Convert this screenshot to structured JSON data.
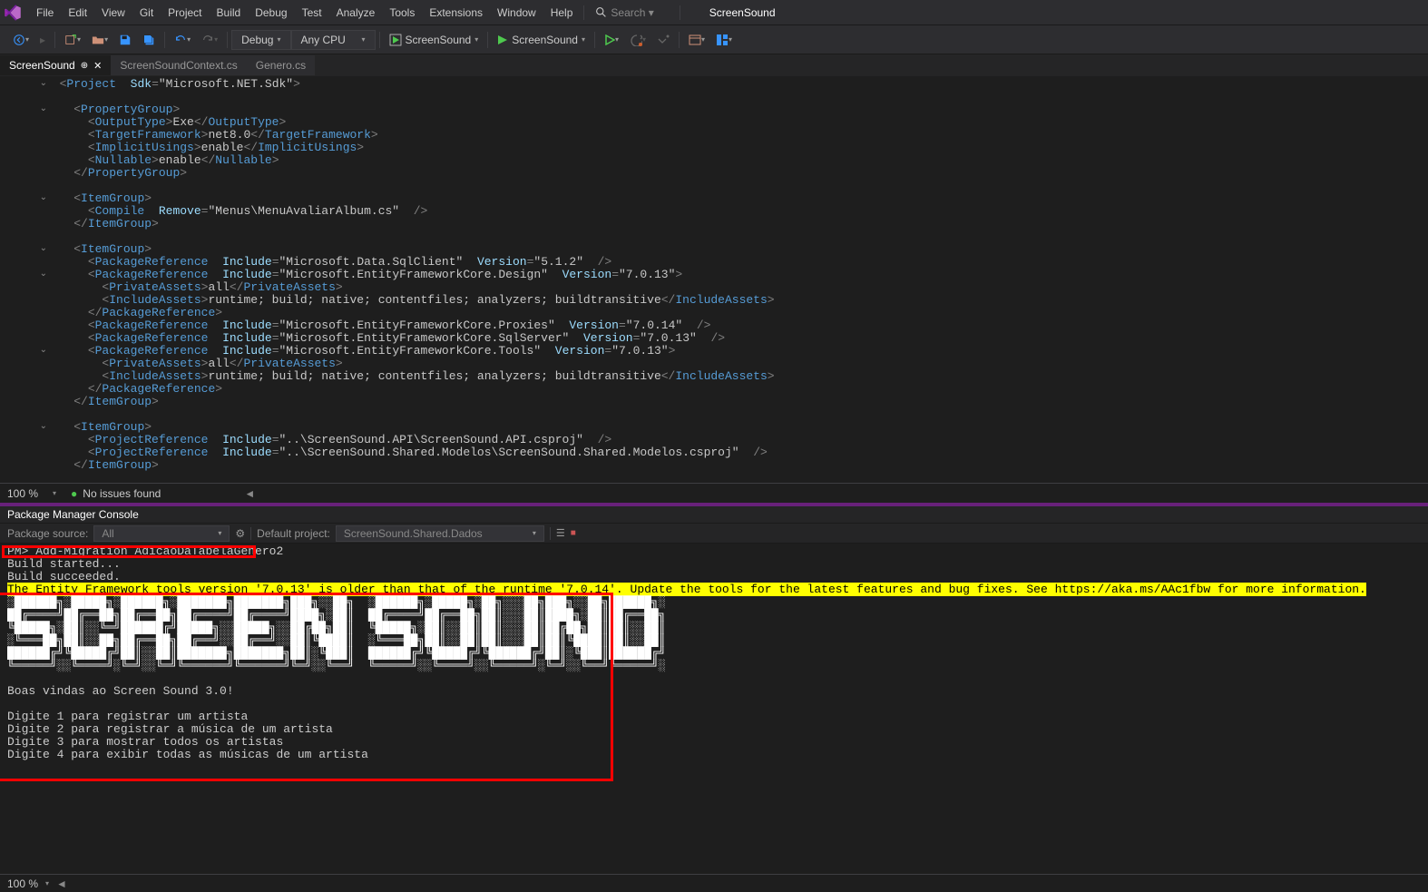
{
  "app_title": "ScreenSound",
  "menubar": [
    "File",
    "Edit",
    "View",
    "Git",
    "Project",
    "Build",
    "Debug",
    "Test",
    "Analyze",
    "Tools",
    "Extensions",
    "Window",
    "Help"
  ],
  "search_placeholder": "Search ▾",
  "toolbar": {
    "debug_config": "Debug",
    "platform": "Any CPU",
    "startup1": "ScreenSound",
    "startup2": "ScreenSound"
  },
  "tabs": [
    {
      "label": "ScreenSound",
      "active": true,
      "pinned": true
    },
    {
      "label": "ScreenSoundContext.cs",
      "active": false,
      "pinned": false
    },
    {
      "label": "Genero.cs",
      "active": false,
      "pinned": false
    }
  ],
  "editor_lines": [
    {
      "collapse": "▾",
      "indent": 0,
      "raw": "<Project Sdk=\"Microsoft.NET.Sdk\">"
    },
    {
      "indent": 0,
      "raw": ""
    },
    {
      "collapse": "▾",
      "indent": 1,
      "raw": "<PropertyGroup>"
    },
    {
      "indent": 2,
      "raw": "<OutputType>Exe</OutputType>"
    },
    {
      "indent": 2,
      "raw": "<TargetFramework>net8.0</TargetFramework>"
    },
    {
      "indent": 2,
      "raw": "<ImplicitUsings>enable</ImplicitUsings>"
    },
    {
      "indent": 2,
      "raw": "<Nullable>enable</Nullable>"
    },
    {
      "indent": 1,
      "raw": "</PropertyGroup>"
    },
    {
      "indent": 0,
      "raw": ""
    },
    {
      "collapse": "▾",
      "indent": 1,
      "raw": "<ItemGroup>"
    },
    {
      "indent": 2,
      "raw": "<Compile Remove=\"Menus\\MenuAvaliarAlbum.cs\" />"
    },
    {
      "indent": 1,
      "raw": "</ItemGroup>"
    },
    {
      "indent": 0,
      "raw": ""
    },
    {
      "collapse": "▾",
      "indent": 1,
      "raw": "<ItemGroup>"
    },
    {
      "indent": 2,
      "raw": "<PackageReference Include=\"Microsoft.Data.SqlClient\" Version=\"5.1.2\" />"
    },
    {
      "collapse": "▾",
      "indent": 2,
      "raw": "<PackageReference Include=\"Microsoft.EntityFrameworkCore.Design\" Version=\"7.0.13\">"
    },
    {
      "indent": 3,
      "raw": "<PrivateAssets>all</PrivateAssets>"
    },
    {
      "indent": 3,
      "raw": "<IncludeAssets>runtime; build; native; contentfiles; analyzers; buildtransitive</IncludeAssets>"
    },
    {
      "indent": 2,
      "raw": "</PackageReference>"
    },
    {
      "indent": 2,
      "raw": "<PackageReference Include=\"Microsoft.EntityFrameworkCore.Proxies\" Version=\"7.0.14\" />"
    },
    {
      "indent": 2,
      "raw": "<PackageReference Include=\"Microsoft.EntityFrameworkCore.SqlServer\" Version=\"7.0.13\" />"
    },
    {
      "collapse": "▾",
      "indent": 2,
      "raw": "<PackageReference Include=\"Microsoft.EntityFrameworkCore.Tools\" Version=\"7.0.13\">"
    },
    {
      "indent": 3,
      "raw": "<PrivateAssets>all</PrivateAssets>"
    },
    {
      "indent": 3,
      "raw": "<IncludeAssets>runtime; build; native; contentfiles; analyzers; buildtransitive</IncludeAssets>"
    },
    {
      "indent": 2,
      "raw": "</PackageReference>"
    },
    {
      "indent": 1,
      "raw": "</ItemGroup>"
    },
    {
      "indent": 0,
      "raw": ""
    },
    {
      "collapse": "▾",
      "indent": 1,
      "raw": "<ItemGroup>"
    },
    {
      "indent": 2,
      "raw": "<ProjectReference Include=\"..\\ScreenSound.API\\ScreenSound.API.csproj\" />"
    },
    {
      "indent": 2,
      "raw": "<ProjectReference Include=\"..\\ScreenSound.Shared.Modelos\\ScreenSound.Shared.Modelos.csproj\" />"
    },
    {
      "indent": 1,
      "raw": "</ItemGroup>"
    }
  ],
  "editor_status": {
    "zoom": "100 %",
    "issues": "No issues found"
  },
  "panel": {
    "title": "Package Manager Console",
    "source_label": "Package source:",
    "source_value": "All",
    "default_label": "Default project:",
    "default_value": "ScreenSound.Shared.Dados"
  },
  "console": {
    "prompt": "PM>",
    "command": "Add-Migration AdicaoDaTabelaGenero2",
    "build_started": "Build started...",
    "build_succeeded": "Build succeeded.",
    "warning": "The Entity Framework tools version '7.0.13' is older than that of the runtime '7.0.14'. Update the tools for the latest features and bug fixes. See https://aka.ms/AAc1fbw for more information.",
    "ascii": "░██████╗░█████╗░██████╗░███████╗███████╗███╗░░██╗  ░██████╗░█████╗░██╗░░░██╗███╗░░██╗██████╗░\n██╔════╝██╔══██╗██╔══██╗██╔════╝██╔════╝████╗░██║  ██╔════╝██╔══██╗██║░░░██║████╗░██║██╔══██╗\n╚█████╗░██║░░╚═╝██████╔╝█████╗░░█████╗░░██╔██╗██║  ╚█████╗░██║░░██║██║░░░██║██╔██╗██║██║░░██║\n░╚═══██╗██║░░██╗██╔══██╗██╔══╝░░██╔══╝░░██║╚████║  ░╚═══██╗██║░░██║██║░░░██║██║╚████║██║░░██║\n██████╔╝╚█████╔╝██║░░██║███████╗███████╗██║░╚███║  ██████╔╝╚█████╔╝╚██████╔╝██║░╚███║██████╔╝\n╚═════╝░░╚════╝░╚═╝░░╚═╝╚══════╝╚══════╝╚═╝░░╚══╝  ╚═════╝░░╚════╝░░╚═════╝░╚═╝░░╚══╝╚═════╝░",
    "welcome": "Boas vindas ao Screen Sound 3.0!",
    "menu_lines": [
      "Digite 1 para registrar um artista",
      "Digite 2 para registrar a música de um artista",
      "Digite 3 para mostrar todos os artistas",
      "Digite 4 para exibir todas as músicas de um artista"
    ]
  },
  "status_bottom": {
    "zoom": "100 %"
  }
}
